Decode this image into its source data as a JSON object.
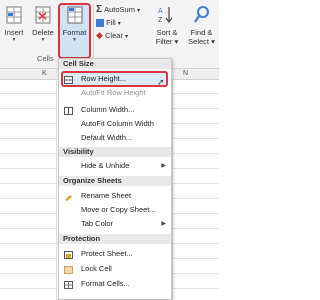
{
  "ribbon": {
    "insert_label": "Insert",
    "delete_label": "Delete",
    "format_label": "Format",
    "cells_group": "Cells",
    "autosum_label": "AutoSum",
    "fill_label": "Fill",
    "clear_label": "Clear",
    "sort_filter_label": "Sort &",
    "sort_filter_label2": "Filter",
    "find_select_label": "Find &",
    "find_select_label2": "Select",
    "accent": "#d9363e"
  },
  "sheet": {
    "col_k": "K",
    "col_n": "N"
  },
  "menu": {
    "cell_size_header": "Cell Size",
    "row_height": "Row Height...",
    "autofit_row": "AutoFit Row Height",
    "column_width": "Column Width...",
    "autofit_col": "AutoFit Column Width",
    "default_width": "Default Width...",
    "visibility_header": "Visibility",
    "hide_unhide": "Hide & Unhide",
    "organize_header": "Organize Sheets",
    "rename_sheet": "Rename Sheet",
    "move_copy": "Move or Copy Sheet...",
    "tab_color": "Tab Color",
    "protection_header": "Protection",
    "protect_sheet": "Protect Sheet...",
    "lock_cell": "Lock Cell",
    "format_cells": "Format Cells..."
  }
}
